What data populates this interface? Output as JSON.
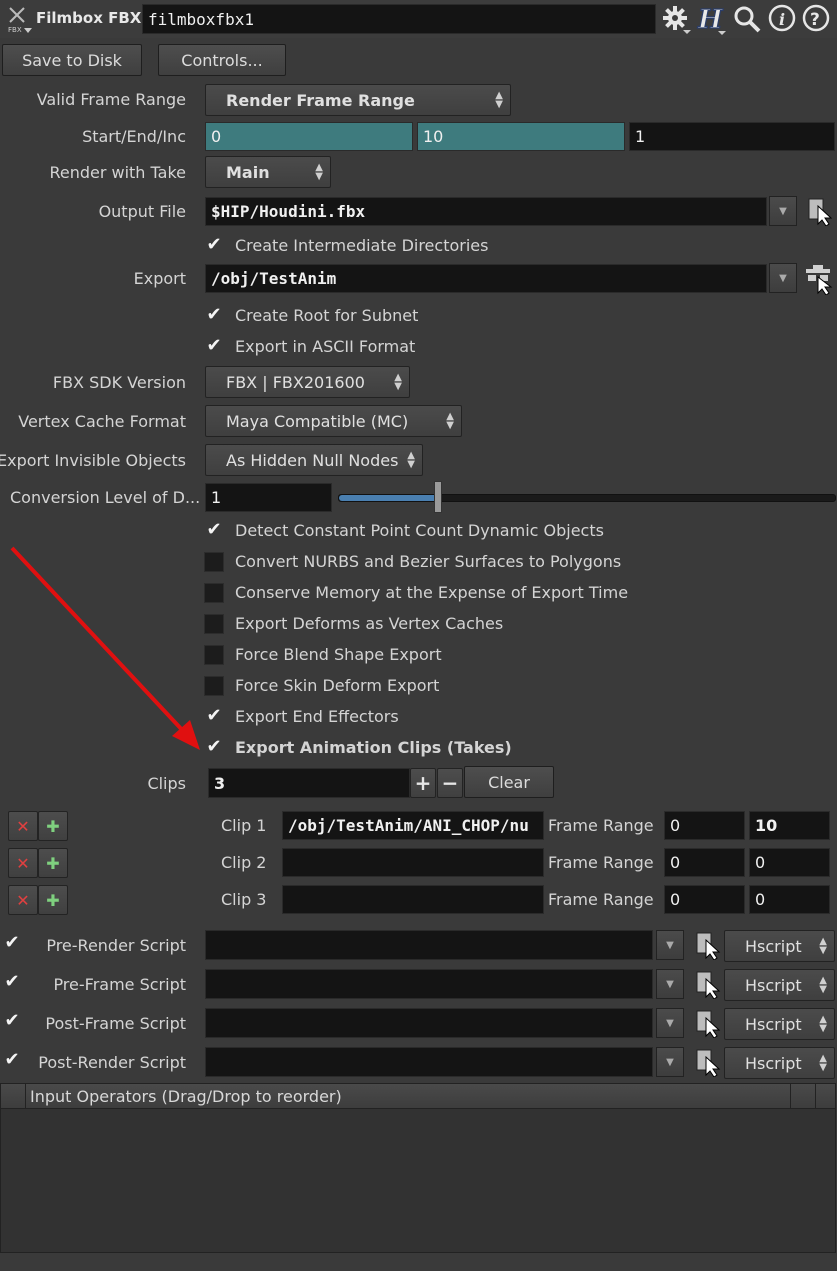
{
  "header": {
    "node_type": "Filmbox FBX",
    "node_name": "filmboxfbx1",
    "icon_badge": "FBX"
  },
  "toolbar": {
    "save_label": "Save to Disk",
    "controls_label": "Controls..."
  },
  "params": {
    "valid_frame_range": {
      "label": "Valid Frame Range",
      "value": "Render Frame Range"
    },
    "start_end_inc": {
      "label": "Start/End/Inc",
      "start": "0",
      "end": "10",
      "inc": "1"
    },
    "render_take": {
      "label": "Render with Take",
      "value": "Main"
    },
    "output_file": {
      "label": "Output File",
      "value": "$HIP/Houdini.fbx"
    },
    "create_dirs": {
      "label": "Create Intermediate Directories",
      "checked": true
    },
    "export": {
      "label": "Export",
      "value": "/obj/TestAnim"
    },
    "create_root": {
      "label": "Create Root for Subnet",
      "checked": true
    },
    "ascii": {
      "label": "Export in ASCII Format",
      "checked": true
    },
    "sdk_version": {
      "label": "FBX SDK Version",
      "value": "FBX | FBX201600"
    },
    "vertex_cache": {
      "label": "Vertex Cache Format",
      "value": "Maya Compatible (MC)"
    },
    "invisible": {
      "label": "Export Invisible Objects",
      "value": "As Hidden Null Nodes"
    },
    "conversion": {
      "label": "Conversion Level of D...",
      "value": "1",
      "slider_fraction": 0.2
    },
    "checks": [
      {
        "label": "Detect Constant Point Count Dynamic Objects",
        "checked": true
      },
      {
        "label": "Convert NURBS and Bezier Surfaces to Polygons",
        "checked": false
      },
      {
        "label": "Conserve Memory at the Expense of Export Time",
        "checked": false
      },
      {
        "label": "Export Deforms as Vertex Caches",
        "checked": false
      },
      {
        "label": "Force Blend Shape Export",
        "checked": false
      },
      {
        "label": "Force Skin Deform Export",
        "checked": false
      },
      {
        "label": "Export End Effectors",
        "checked": true
      },
      {
        "label": "Export Animation Clips (Takes)",
        "checked": true
      }
    ],
    "clips": {
      "label": "Clips",
      "value": "3",
      "clear_label": "Clear",
      "plus": "+",
      "minus": "−"
    },
    "clip_rows": [
      {
        "label": "Clip 1",
        "path": "/obj/TestAnim/ANI_CHOP/nu",
        "range_label": "Frame Range",
        "start": "0",
        "end": "10"
      },
      {
        "label": "Clip 2",
        "path": "",
        "range_label": "Frame Range",
        "start": "0",
        "end": "0"
      },
      {
        "label": "Clip 3",
        "path": "",
        "range_label": "Frame Range",
        "start": "0",
        "end": "0"
      }
    ],
    "scripts": [
      {
        "label": "Pre-Render Script",
        "lang": "Hscript",
        "checked": true
      },
      {
        "label": "Pre-Frame Script",
        "lang": "Hscript",
        "checked": true
      },
      {
        "label": "Post-Frame Script",
        "lang": "Hscript",
        "checked": true
      },
      {
        "label": "Post-Render Script",
        "lang": "Hscript",
        "checked": true
      }
    ],
    "input_ops_header": "Input Operators (Drag/Drop to reorder)"
  },
  "icons": [
    "gear-icon",
    "houdini-help-icon",
    "search-icon",
    "info-icon",
    "question-icon",
    "file-chooser-icon",
    "node-chooser-icon"
  ],
  "colors": {
    "teal_field": "#3e7b7e",
    "bg": "#3a3a3a",
    "annotation_arrow": "#e01010",
    "slider_blue": "#4a7fb0"
  }
}
